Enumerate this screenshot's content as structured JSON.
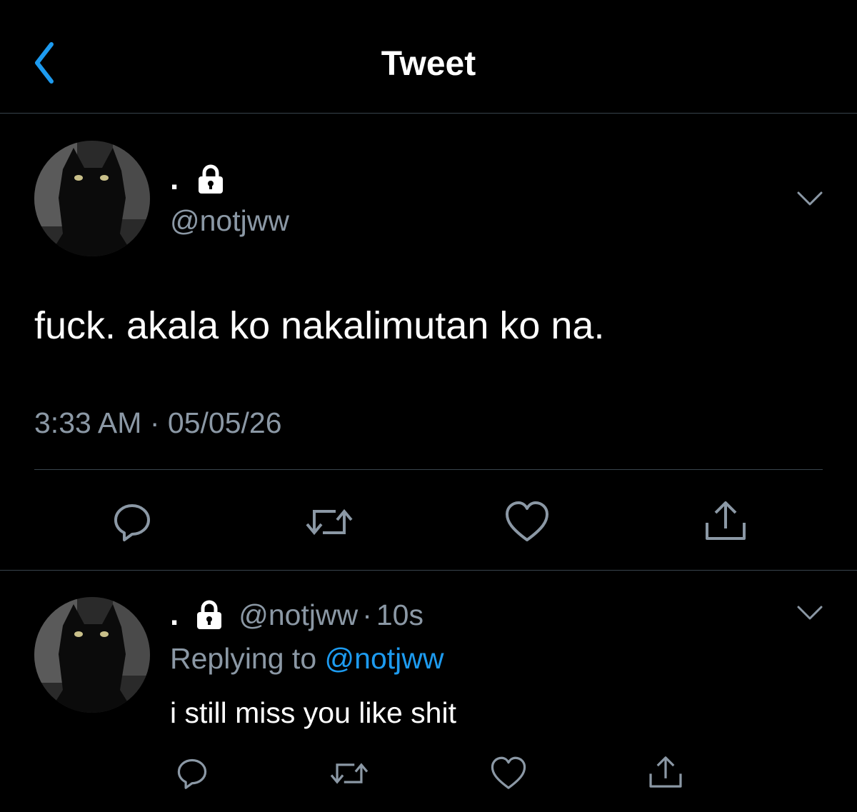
{
  "nav": {
    "title": "Tweet",
    "back_icon": "chevron-left-icon"
  },
  "tweet": {
    "display_name": ".",
    "handle": "@notjww",
    "text": "fuck. akala ko nakalimutan ko na.",
    "time": "3:33 AM",
    "separator": "·",
    "date": "05/05/26",
    "avatar": "black-cat-avatar",
    "badge": "lock-icon"
  },
  "reply": {
    "display_name": ".",
    "handle": "@notjww",
    "separator": "·",
    "age": "10s",
    "replying_prefix": "Replying to",
    "replying_handle": "@notjww",
    "text": "i still miss you like shit",
    "avatar": "black-cat-avatar",
    "badge": "lock-icon"
  },
  "actions": [
    "reply-icon",
    "retweet-icon",
    "like-icon",
    "share-icon"
  ],
  "colors": {
    "background": "#000000",
    "accent": "#1d9bf0",
    "muted": "#8b98a5",
    "divider": "#38444d"
  }
}
